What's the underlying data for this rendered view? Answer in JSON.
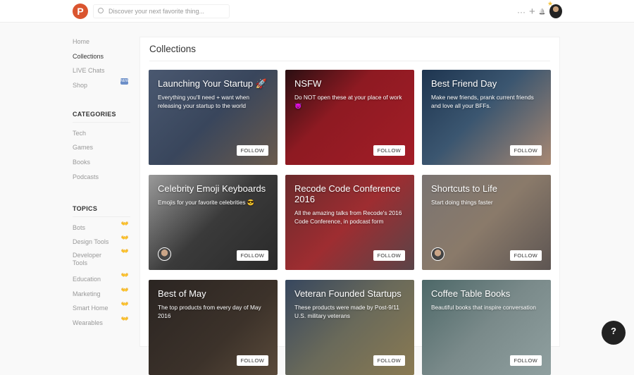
{
  "header": {
    "logo": "P",
    "search_placeholder": "Discover your next favorite thing...",
    "more": "···",
    "add": "+",
    "bell": "🔔"
  },
  "sidebar": {
    "nav": [
      "Home",
      "Collections",
      "LIVE Chats",
      "Shop"
    ],
    "shop_badge": "NEW",
    "categories_title": "CATEGORIES",
    "categories": [
      "Tech",
      "Games",
      "Books",
      "Podcasts"
    ],
    "topics_title": "TOPICS",
    "topics": [
      "Bots",
      "Design Tools",
      "Developer Tools",
      "Education",
      "Marketing",
      "Smart Home",
      "Wearables"
    ],
    "topic_icon": "👐"
  },
  "main": {
    "title": "Collections",
    "follow_label": "FOLLOW",
    "cards": [
      {
        "title": "Launching Your Startup 🚀",
        "desc": "Everything you'll need + want when releasing your startup to the world"
      },
      {
        "title": "NSFW",
        "desc": "Do NOT open these at your place of work 😈"
      },
      {
        "title": "Best Friend Day",
        "desc": "Make new friends, prank current friends and love all your BFFs."
      },
      {
        "title": "Celebrity Emoji Keyboards",
        "desc": "Emojis for your favorite celebrities 😎"
      },
      {
        "title": "Recode Code Conference 2016",
        "desc": "All the amazing talks from Recode's 2016 Code Conference, in podcast form"
      },
      {
        "title": "Shortcuts to Life",
        "desc": "Start doing things faster"
      },
      {
        "title": "Best of May",
        "desc": "The top products from every day of May 2016"
      },
      {
        "title": "Veteran Founded Startups",
        "desc": "These products were made by Post-9/11 U.S. military veterans"
      },
      {
        "title": "Coffee Table Books",
        "desc": "Beautiful books that inspire conversation"
      }
    ]
  },
  "chat_icon": "?"
}
